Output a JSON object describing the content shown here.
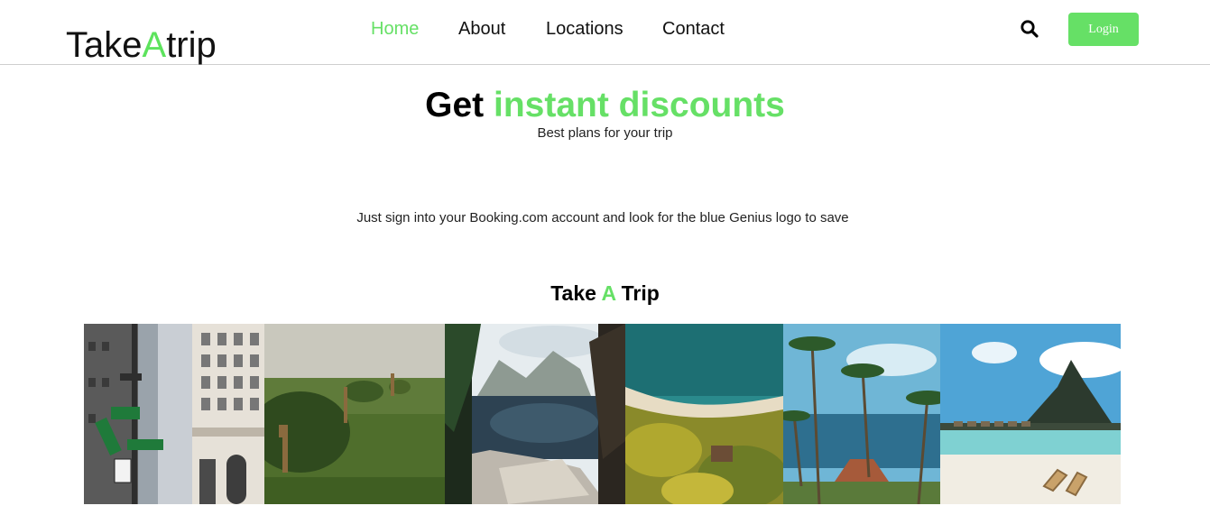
{
  "logo": {
    "part1": "Take",
    "accent": "A",
    "part2": "trip"
  },
  "nav": {
    "items": [
      {
        "label": "Home",
        "active": true
      },
      {
        "label": "About",
        "active": false
      },
      {
        "label": "Locations",
        "active": false
      },
      {
        "label": "Contact",
        "active": false
      }
    ]
  },
  "header": {
    "search_icon": "search-icon",
    "login_label": "Login"
  },
  "hero": {
    "title_plain": "Get",
    "title_accent": "instant discounts",
    "subtitle": "Best plans for your trip"
  },
  "description": "Just sign into your Booking.com account and look for the blue Genius logo to save",
  "section": {
    "part1": "Take",
    "accent": "A",
    "part2": "Trip"
  },
  "colors": {
    "accent": "#66e066",
    "text": "#111111",
    "border": "#cfcfcf"
  }
}
